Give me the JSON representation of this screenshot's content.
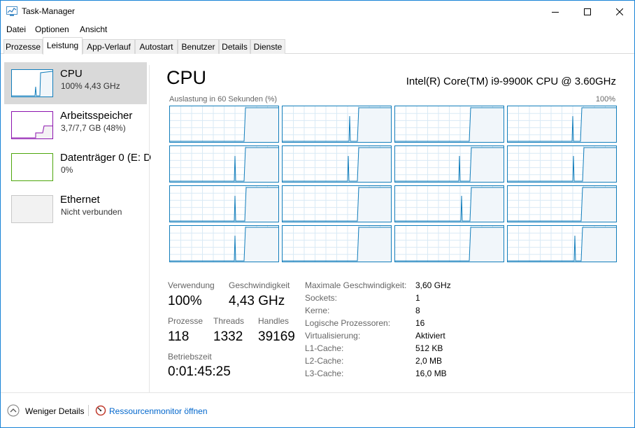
{
  "window": {
    "title": "Task-Manager"
  },
  "menu": [
    "Datei",
    "Optionen",
    "Ansicht"
  ],
  "tabs": [
    "Prozesse",
    "Leistung",
    "App-Verlauf",
    "Autostart",
    "Benutzer",
    "Details",
    "Dienste"
  ],
  "sidebar": [
    {
      "name": "CPU",
      "sub": "100% 4,43 GHz",
      "color": "#117dbb"
    },
    {
      "name": "Arbeitsspeicher",
      "sub": "3,7/7,7 GB (48%)",
      "color": "#8b12ae"
    },
    {
      "name": "Datenträger 0 (E: D",
      "sub": "0%",
      "color": "#4da60c"
    },
    {
      "name": "Ethernet",
      "sub": "Nicht verbunden",
      "color": "#a5a5a5"
    }
  ],
  "main": {
    "title": "CPU",
    "model": "Intel(R) Core(TM) i9-9900K CPU @ 3.60GHz",
    "graph_caption": "Auslastung in 60 Sekunden (%)",
    "graph_max": "100%"
  },
  "stats": {
    "usage_label": "Verwendung",
    "usage_value": "100%",
    "speed_label": "Geschwindigkeit",
    "speed_value": "4,43 GHz",
    "processes_label": "Prozesse",
    "processes_value": "118",
    "threads_label": "Threads",
    "threads_value": "1332",
    "handles_label": "Handles",
    "handles_value": "39169",
    "uptime_label": "Betriebszeit",
    "uptime_value": "0:01:45:25"
  },
  "info": [
    {
      "label": "Maximale Geschwindigkeit:",
      "value": "3,60 GHz"
    },
    {
      "label": "Sockets:",
      "value": "1"
    },
    {
      "label": "Kerne:",
      "value": "8"
    },
    {
      "label": "Logische Prozessoren:",
      "value": "16"
    },
    {
      "label": "Virtualisierung:",
      "value": "Aktiviert"
    },
    {
      "label": "L1-Cache:",
      "value": "512 KB"
    },
    {
      "label": "L2-Cache:",
      "value": "2,0 MB"
    },
    {
      "label": "L3-Cache:",
      "value": "16,0 MB"
    }
  ],
  "footer": {
    "fewer_details": "Weniger Details",
    "resource_monitor": "Ressourcenmonitor öffnen"
  },
  "icons": {
    "app": "task-manager-icon",
    "minimize": "minimize-icon",
    "maximize": "maximize-icon",
    "close": "close-icon",
    "collapse": "chevron-up-circle-icon",
    "resmon": "resource-monitor-icon"
  },
  "colors": {
    "cpu": "#117dbb",
    "cpu_fill": "#f1f6fa",
    "memory": "#8b12ae",
    "disk": "#4da60c",
    "ethernet": "#a5a5a5",
    "link": "#0066cc"
  }
}
